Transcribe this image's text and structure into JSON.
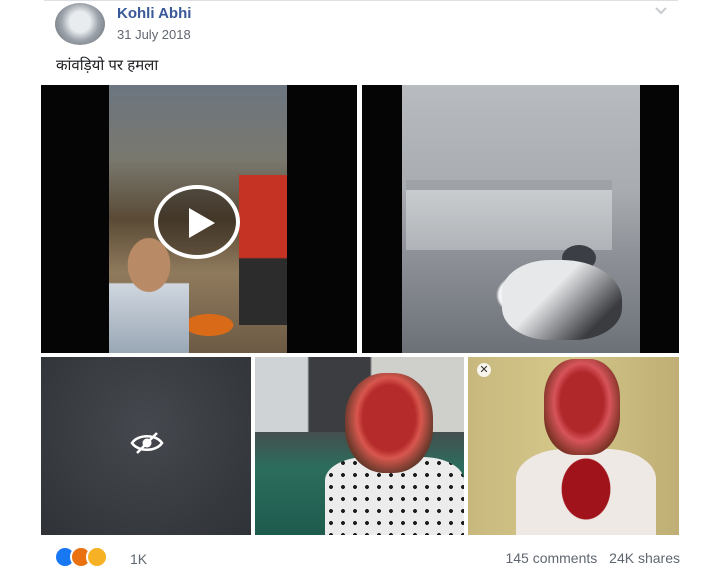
{
  "post": {
    "author": "Kohli Abhi",
    "date": "31 July 2018",
    "caption": "कांवड़ियो पर हमला"
  },
  "media": {
    "tiles": [
      {
        "kind": "video",
        "icon": "play-icon"
      },
      {
        "kind": "image"
      },
      {
        "kind": "image",
        "icon": "hidden-eye-icon"
      },
      {
        "kind": "image"
      },
      {
        "kind": "image",
        "icon": "close-icon"
      }
    ]
  },
  "footer": {
    "reactions": [
      "like",
      "angry",
      "sad"
    ],
    "reaction_count": "1K",
    "comments": "145 comments",
    "shares": "24K shares"
  },
  "colors": {
    "author_link": "#385898",
    "like": "#1877f2",
    "angry": "#e9710f",
    "sad": "#f7b125",
    "meta_text": "#616770"
  }
}
